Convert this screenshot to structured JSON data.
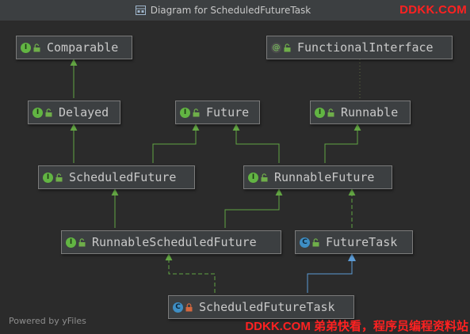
{
  "window": {
    "title": "Diagram for ScheduledFutureTask",
    "title_icon": "uml-diagram-icon"
  },
  "watermark": {
    "top": "DDKK.COM",
    "bottom": "DDKK.COM 弟弟快看，程序员编程资料站"
  },
  "footer": {
    "powered_by": "Powered by yFiles"
  },
  "colors": {
    "background": "#2b2b2b",
    "node_fill": "#3c3f41",
    "node_border": "#7b7b7b",
    "interface_badge": "#62b543",
    "class_badge": "#3e8ec4",
    "extends_edge": "#62a543",
    "implements_edge": "#5b9bd5",
    "watermark": "#ff2121"
  },
  "nodes": {
    "comparable": {
      "label": "Comparable",
      "kind": "interface",
      "visibility": "public"
    },
    "functional_interface": {
      "label": "FunctionalInterface",
      "kind": "annotation",
      "visibility": "public"
    },
    "delayed": {
      "label": "Delayed",
      "kind": "interface",
      "visibility": "public"
    },
    "future": {
      "label": "Future",
      "kind": "interface",
      "visibility": "public"
    },
    "runnable": {
      "label": "Runnable",
      "kind": "interface",
      "visibility": "public"
    },
    "scheduled_future": {
      "label": "ScheduledFuture",
      "kind": "interface",
      "visibility": "public"
    },
    "runnable_future": {
      "label": "RunnableFuture",
      "kind": "interface",
      "visibility": "public"
    },
    "runnable_scheduled_future": {
      "label": "RunnableScheduledFuture",
      "kind": "interface",
      "visibility": "public"
    },
    "future_task": {
      "label": "FutureTask",
      "kind": "class",
      "visibility": "public"
    },
    "scheduled_future_task": {
      "label": "ScheduledFutureTask",
      "kind": "class",
      "visibility": "private"
    }
  }
}
